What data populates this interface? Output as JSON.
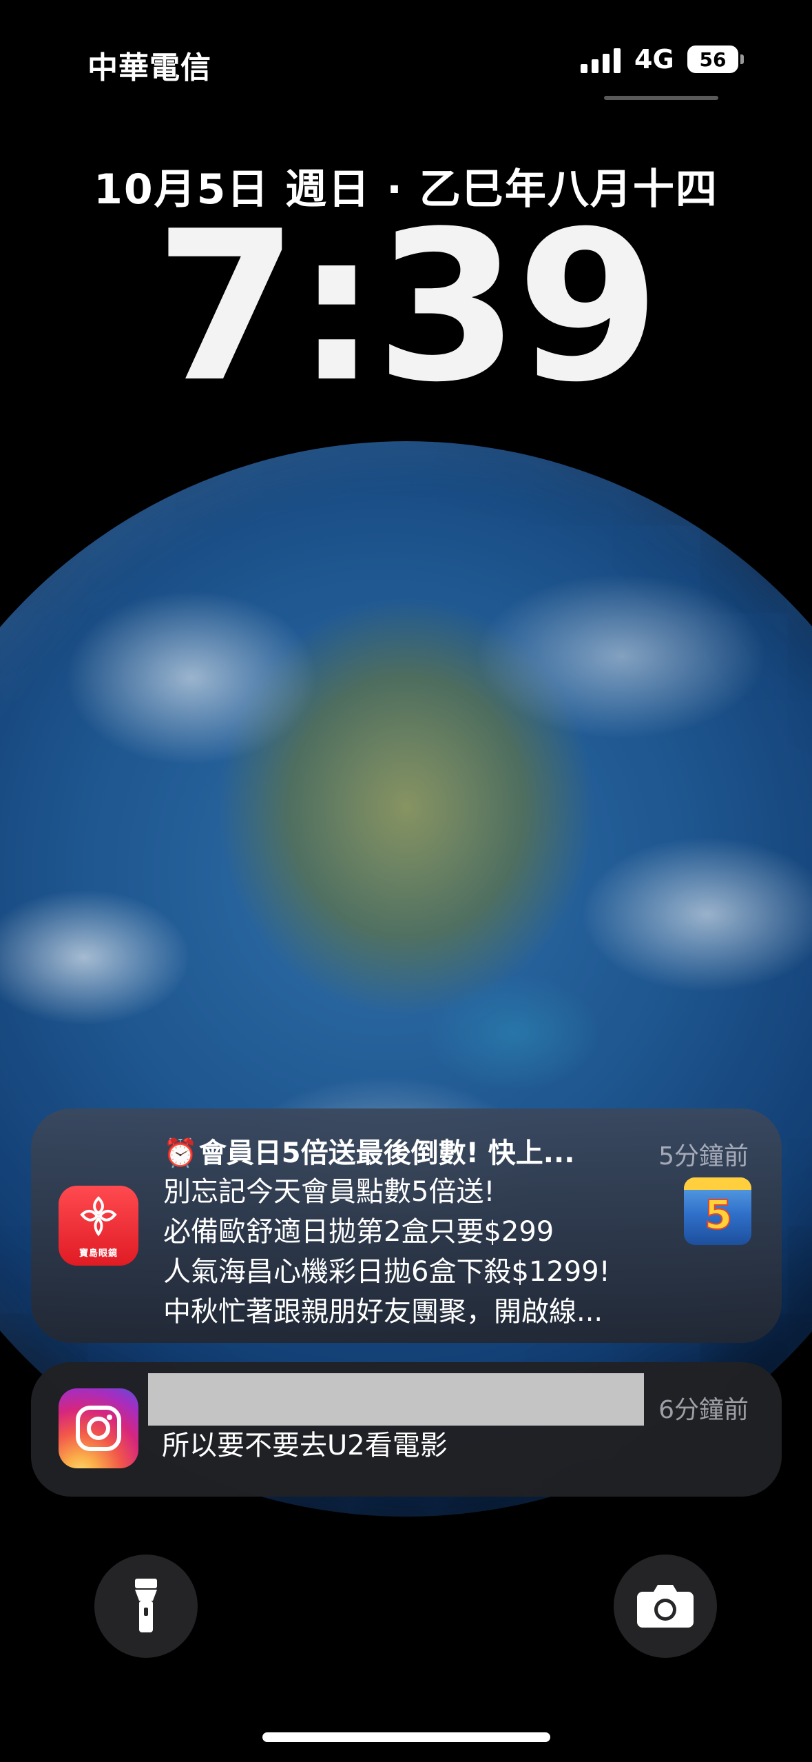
{
  "status_bar": {
    "carrier": "中華電信",
    "network": "4G",
    "battery": "56"
  },
  "lock_screen": {
    "date": "10月5日 週日 · 乙巳年八月十四",
    "time": "7:39"
  },
  "notifications": [
    {
      "app_icon": "optical-store-app-icon",
      "app_icon_caption": "寶島眼鏡",
      "title_emoji": "⏰",
      "title": "會員日5倍送最後倒數! 快上...",
      "time": "5分鐘前",
      "body_lines": [
        "別忘記今天會員點數5倍送!",
        "必備歐舒適日拋第2盒只要$299",
        "人氣海昌心機彩日拋6盒下殺$1299!",
        "中秋忙著跟親朋好友團聚，開啟線..."
      ],
      "thumbnail_label": "5"
    },
    {
      "app_icon": "instagram-icon",
      "time": "6分鐘前",
      "body": "所以要不要去U2看電影"
    }
  ],
  "controls": {
    "flashlight_icon": "flashlight-icon",
    "camera_icon": "camera-icon"
  }
}
